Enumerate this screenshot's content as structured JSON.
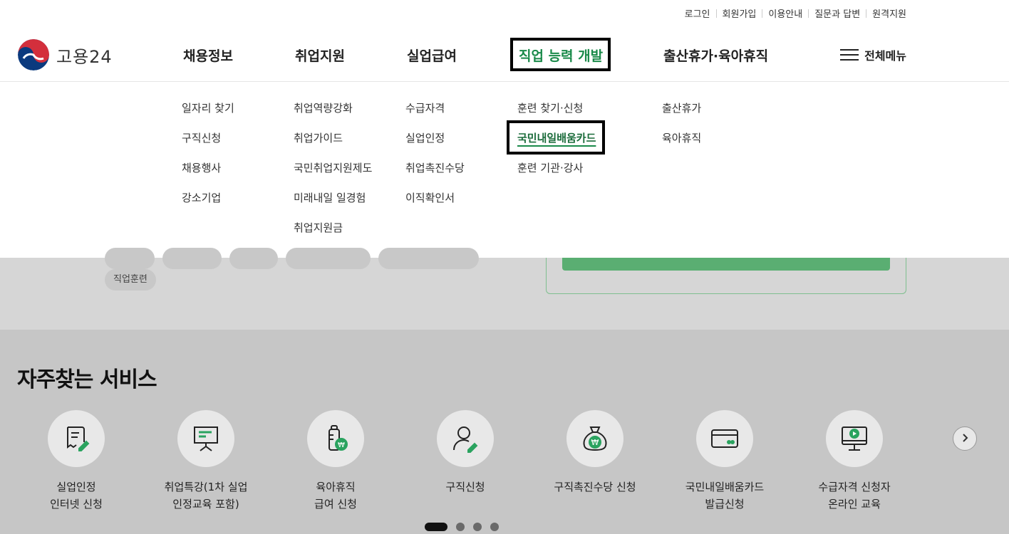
{
  "utility_links": [
    "로그인",
    "회원가입",
    "이용안내",
    "질문과 답변",
    "원격지원"
  ],
  "logo": {
    "text": "고용24"
  },
  "nav": [
    {
      "label": "채용정보"
    },
    {
      "label": "취업지원"
    },
    {
      "label": "실업급여"
    },
    {
      "label": "직업 능력 개발",
      "active": true
    },
    {
      "label": "출산휴가·육아휴직"
    }
  ],
  "all_menu_label": "전체메뉴",
  "mega_menu": [
    [
      "일자리 찾기",
      "구직신청",
      "채용행사",
      "강소기업"
    ],
    [
      "취업역량강화",
      "취업가이드",
      "국민취업지원제도",
      "미래내일 일경험",
      "취업지원금"
    ],
    [
      "수급자격",
      "실업인정",
      "취업촉진수당",
      "이직확인서"
    ],
    [
      "훈련 찾기·신청",
      "국민내일배움카드",
      "훈련 기관·강사"
    ],
    [
      "출산휴가",
      "육아휴직"
    ]
  ],
  "background_chip": "직업훈련",
  "services": {
    "title": "자주찾는 서비스",
    "items": [
      {
        "label": "실업인정\n인터넷 신청",
        "icon": "document-pen-icon"
      },
      {
        "label": "취업특강(1차 실업\n인정교육 포함)",
        "icon": "presentation-board-icon"
      },
      {
        "label": "육아휴직\n급여 신청",
        "icon": "baby-bottle-won-icon"
      },
      {
        "label": "구직신청",
        "icon": "person-pen-icon"
      },
      {
        "label": "구직촉진수당 신청",
        "icon": "money-bag-won-icon"
      },
      {
        "label": "국민내일배움카드\n발급신청",
        "icon": "card-icon"
      },
      {
        "label": "수급자격 신청자\n온라인 교육",
        "icon": "monitor-play-icon"
      }
    ]
  },
  "carousel": {
    "pages": 4,
    "current": 1
  },
  "colors": {
    "accent": "#1a8a4a",
    "highlight_box": "#000000"
  }
}
